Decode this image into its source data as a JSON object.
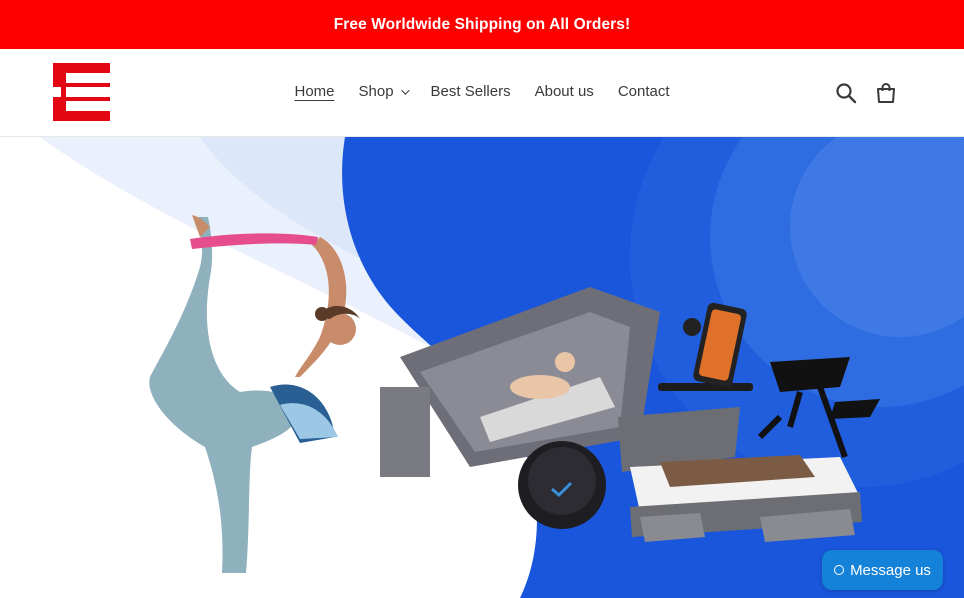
{
  "announcement": {
    "text": "Free Worldwide Shipping on All Orders!"
  },
  "header": {
    "logo_alt": "E",
    "nav": [
      {
        "label": "Home",
        "active": true
      },
      {
        "label": "Shop",
        "has_dropdown": true
      },
      {
        "label": "Best Sellers"
      },
      {
        "label": "About us"
      },
      {
        "label": "Contact"
      }
    ],
    "icons": [
      "search-icon",
      "cart-icon"
    ]
  },
  "hero": {
    "image_subjects": [
      "yoga-woman",
      "baby-bag-bed",
      "robot-vacuum",
      "wireless-charger",
      "laptop-stand",
      "storage-bed"
    ]
  },
  "chat": {
    "label": "Message us"
  },
  "colors": {
    "announce_bg": "#ff0000",
    "brand": "#e30613",
    "hero_blue": "#1a56db",
    "chat_bg": "#1482d8"
  }
}
